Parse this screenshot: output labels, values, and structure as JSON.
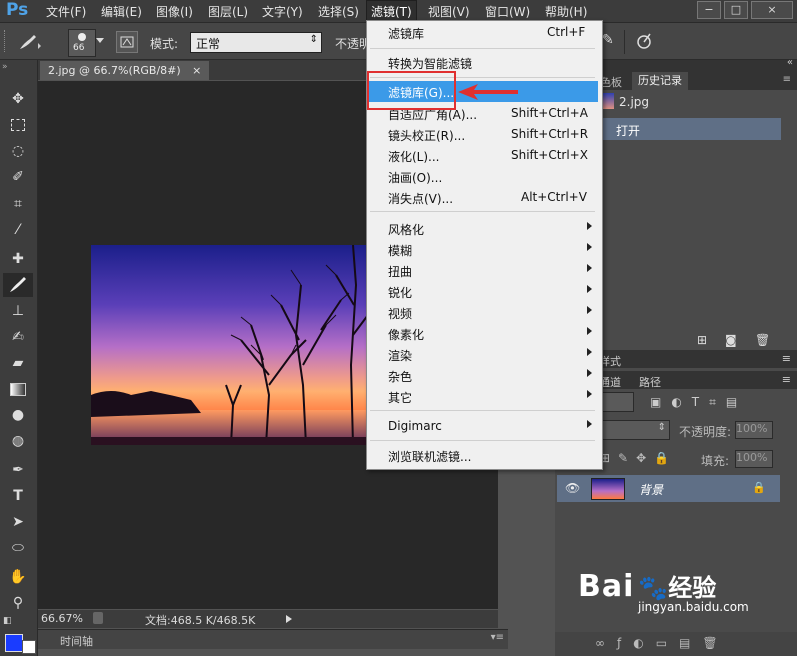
{
  "app": {
    "logo": "Ps"
  },
  "menubar": {
    "items": [
      "文件(F)",
      "编辑(E)",
      "图像(I)",
      "图层(L)",
      "文字(Y)",
      "选择(S)",
      "滤镜(T)",
      "视图(V)",
      "窗口(W)",
      "帮助(H)"
    ],
    "window_buttons": [
      "−",
      "□",
      "×"
    ]
  },
  "options": {
    "brush_size": "66",
    "mode_label": "模式:",
    "mode_value": "正常",
    "opacity_label": "不透明"
  },
  "document": {
    "tab_title": "2.jpg @ 66.7%(RGB/8#)",
    "tab_close": "×",
    "zoom": "66.67%",
    "doc_info": "文档:468.5 K/468.5K",
    "timeline_label": "时间轴"
  },
  "filter_menu": {
    "items": [
      {
        "label": "滤镜库",
        "shortcut": "Ctrl+F"
      },
      {
        "label": "转换为智能滤镜",
        "shortcut": ""
      },
      {
        "label": "滤镜库(G)...",
        "shortcut": ""
      },
      {
        "label": "自适应广角(A)...",
        "shortcut": "Shift+Ctrl+A"
      },
      {
        "label": "镜头校正(R)...",
        "shortcut": "Shift+Ctrl+R"
      },
      {
        "label": "液化(L)...",
        "shortcut": "Shift+Ctrl+X"
      },
      {
        "label": "油画(O)...",
        "shortcut": ""
      },
      {
        "label": "消失点(V)...",
        "shortcut": "Alt+Ctrl+V"
      },
      {
        "label": "风格化",
        "shortcut": ""
      },
      {
        "label": "模糊",
        "shortcut": ""
      },
      {
        "label": "扭曲",
        "shortcut": ""
      },
      {
        "label": "锐化",
        "shortcut": ""
      },
      {
        "label": "视频",
        "shortcut": ""
      },
      {
        "label": "像素化",
        "shortcut": ""
      },
      {
        "label": "渲染",
        "shortcut": ""
      },
      {
        "label": "杂色",
        "shortcut": ""
      },
      {
        "label": "其它",
        "shortcut": ""
      },
      {
        "label": "Digimarc",
        "shortcut": ""
      },
      {
        "label": "浏览联机滤镜...",
        "shortcut": ""
      }
    ]
  },
  "history_panel": {
    "tab_color": "色板",
    "tab_history": "历史记录",
    "snapshot": "2.jpg",
    "step": "打开"
  },
  "layers_panel": {
    "styles_tab": "样式",
    "tab_channels": "通道",
    "tab_paths": "路径",
    "opacity_label": "不透明度:",
    "opacity_value": "100%",
    "fill_label": "填充:",
    "fill_value": "100%",
    "layer_name": "背景"
  },
  "watermark": {
    "brand": "Bai",
    "brand2": "经验",
    "url": "jingyan.baidu.com"
  },
  "colors": {
    "highlight": "#3b9ae8",
    "annotation_red": "#e03030",
    "ps_blue": "#4fa3e8"
  }
}
